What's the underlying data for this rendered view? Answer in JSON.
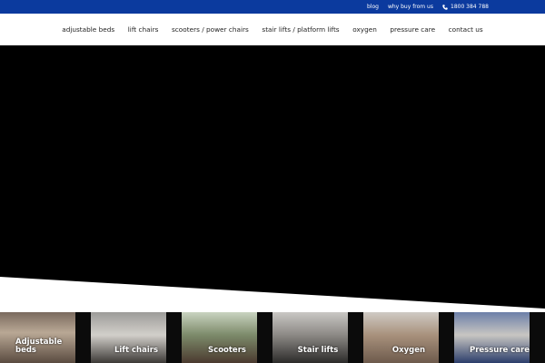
{
  "topbar": {
    "links": [
      "blog",
      "why buy from us"
    ],
    "phone": "1800 384 788",
    "background": "#0b3a9e"
  },
  "nav": {
    "items": [
      "adjustable beds",
      "lift chairs",
      "scooters / power chairs",
      "stair lifts / platform lifts",
      "oxygen",
      "pressure care",
      "contact us"
    ]
  },
  "categories": [
    "Adjustable beds",
    "Lift chairs",
    "Scooters",
    "Stair lifts",
    "Oxygen",
    "Pressure care"
  ]
}
